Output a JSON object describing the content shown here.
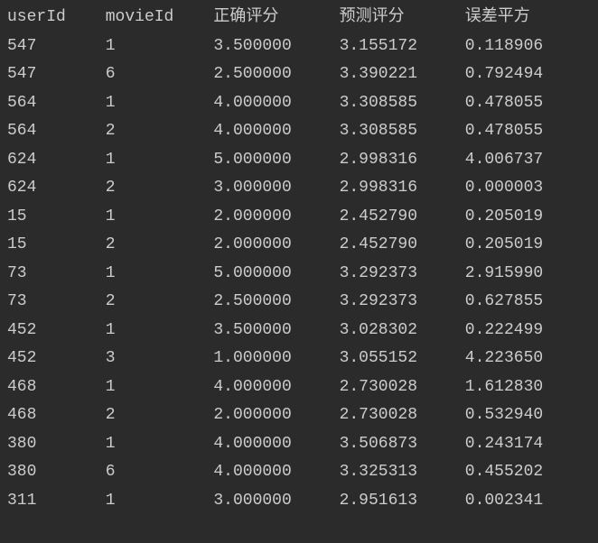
{
  "table": {
    "headers": {
      "userId": "userId",
      "movieId": "movieId",
      "correct": "正确评分",
      "predict": "预测评分",
      "error": "误差平方"
    },
    "rows": [
      {
        "userId": "547",
        "movieId": "1",
        "correct": "3.500000",
        "predict": "3.155172",
        "error": "0.118906"
      },
      {
        "userId": "547",
        "movieId": "6",
        "correct": "2.500000",
        "predict": "3.390221",
        "error": "0.792494"
      },
      {
        "userId": "564",
        "movieId": "1",
        "correct": "4.000000",
        "predict": "3.308585",
        "error": "0.478055"
      },
      {
        "userId": "564",
        "movieId": "2",
        "correct": "4.000000",
        "predict": "3.308585",
        "error": "0.478055"
      },
      {
        "userId": "624",
        "movieId": "1",
        "correct": "5.000000",
        "predict": "2.998316",
        "error": "4.006737"
      },
      {
        "userId": "624",
        "movieId": "2",
        "correct": "3.000000",
        "predict": "2.998316",
        "error": "0.000003"
      },
      {
        "userId": "15",
        "movieId": "1",
        "correct": "2.000000",
        "predict": "2.452790",
        "error": "0.205019"
      },
      {
        "userId": "15",
        "movieId": "2",
        "correct": "2.000000",
        "predict": "2.452790",
        "error": "0.205019"
      },
      {
        "userId": "73",
        "movieId": "1",
        "correct": "5.000000",
        "predict": "3.292373",
        "error": "2.915990"
      },
      {
        "userId": "73",
        "movieId": "2",
        "correct": "2.500000",
        "predict": "3.292373",
        "error": "0.627855"
      },
      {
        "userId": "452",
        "movieId": "1",
        "correct": "3.500000",
        "predict": "3.028302",
        "error": "0.222499"
      },
      {
        "userId": "452",
        "movieId": "3",
        "correct": "1.000000",
        "predict": "3.055152",
        "error": "4.223650"
      },
      {
        "userId": "468",
        "movieId": "1",
        "correct": "4.000000",
        "predict": "2.730028",
        "error": "1.612830"
      },
      {
        "userId": "468",
        "movieId": "2",
        "correct": "2.000000",
        "predict": "2.730028",
        "error": "0.532940"
      },
      {
        "userId": "380",
        "movieId": "1",
        "correct": "4.000000",
        "predict": "3.506873",
        "error": "0.243174"
      },
      {
        "userId": "380",
        "movieId": "6",
        "correct": "4.000000",
        "predict": "3.325313",
        "error": "0.455202"
      },
      {
        "userId": "311",
        "movieId": "1",
        "correct": "3.000000",
        "predict": "2.951613",
        "error": "0.002341"
      }
    ]
  }
}
